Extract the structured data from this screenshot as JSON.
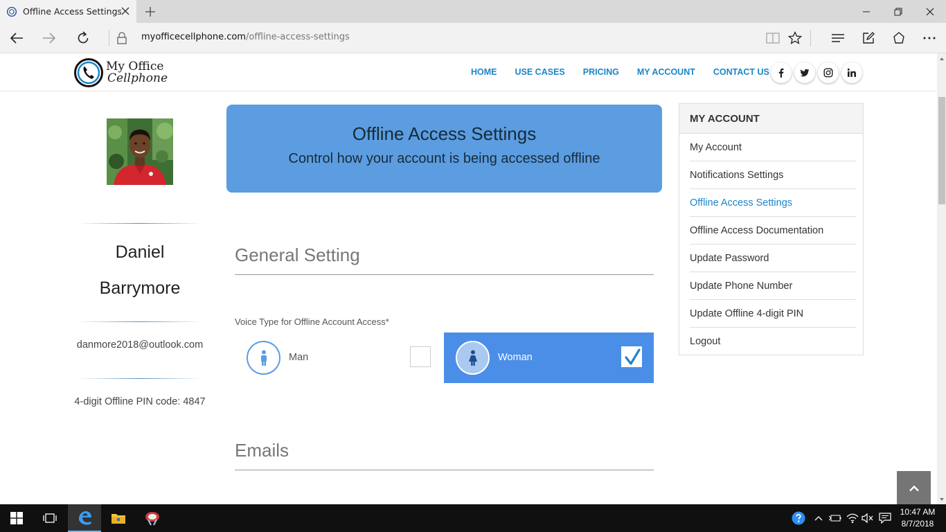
{
  "browser": {
    "tab_title": "Offline Access Settings -",
    "url_domain": "myofficecellphone.com",
    "url_path": "/offline-access-settings"
  },
  "header": {
    "logo_line1": "My Office",
    "logo_line2": "Cellphone",
    "nav": [
      "HOME",
      "USE CASES",
      "PRICING",
      "MY ACCOUNT",
      "CONTACT US"
    ],
    "social_icons": [
      "facebook-icon",
      "twitter-icon",
      "instagram-icon",
      "linkedin-icon"
    ]
  },
  "profile": {
    "first_name": "Daniel",
    "last_name": "Barrymore",
    "email": "danmore2018@outlook.com",
    "pin_text": "4-digit Offline PIN code: 4847"
  },
  "banner": {
    "title": "Offline Access Settings",
    "subtitle": "Control how your account is being accessed offline"
  },
  "form": {
    "general_title": "General Setting",
    "voice_label": "Voice Type for Offline Account Access*",
    "options": [
      {
        "label": "Man",
        "checked": false
      },
      {
        "label": "Woman",
        "checked": true
      }
    ],
    "emails_title": "Emails"
  },
  "sidebar": {
    "title": "MY ACCOUNT",
    "items": [
      "My Account",
      "Notifications Settings",
      "Offline Access Settings",
      "Offline Access Documentation",
      "Update Password",
      "Update Phone Number",
      "Update Offline 4-digit PIN",
      "Logout"
    ],
    "active_item": "Offline Access Settings"
  },
  "taskbar": {
    "time": "10:47 AM",
    "date": "8/7/2018"
  },
  "colors": {
    "accent": "#1a86c8",
    "banner": "#5b9de0",
    "selected_option": "#4a8ee8"
  }
}
